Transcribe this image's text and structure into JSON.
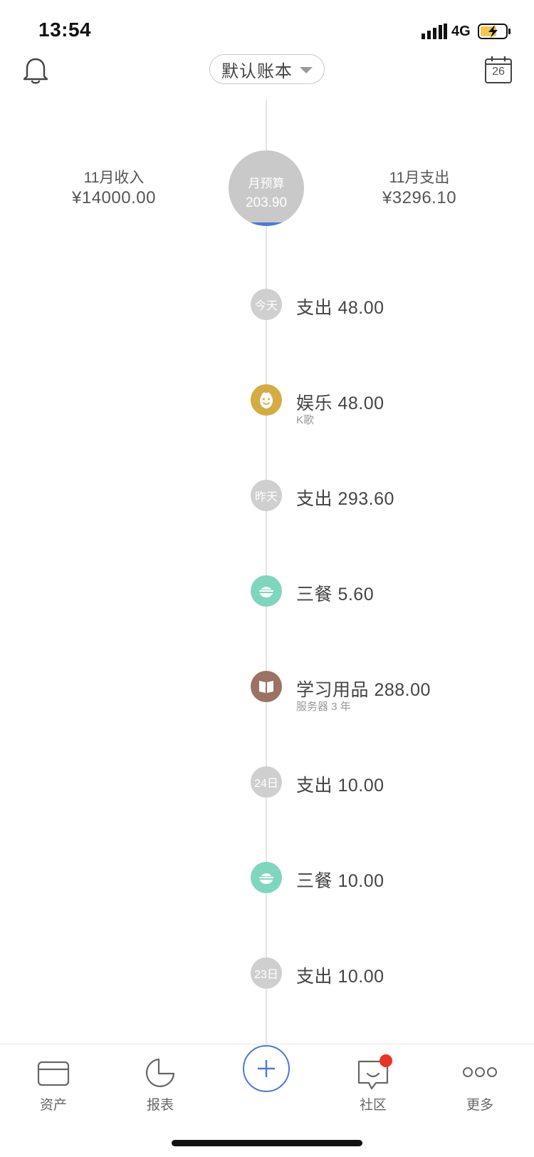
{
  "status_bar": {
    "time": "13:54",
    "network": "4G"
  },
  "header": {
    "ledger_name": "默认账本",
    "calendar_day": "26"
  },
  "summary": {
    "income_label": "11月收入",
    "income_value": "¥14000.00",
    "budget_label": "月预算",
    "budget_value": "203.90",
    "expense_label": "11月支出",
    "expense_value": "¥3296.10"
  },
  "entries": [
    {
      "node_text": "今天",
      "text": "支出 48.00",
      "note": ""
    },
    {
      "icon": "entertainment-icon",
      "text": "娱乐 48.00",
      "note": "K歌",
      "color": "#d4ac43"
    },
    {
      "node_text": "昨天",
      "text": "支出 293.60",
      "note": ""
    },
    {
      "icon": "meal-bowl-icon",
      "text": "三餐 5.60",
      "note": "",
      "color": "#7fd6bf"
    },
    {
      "icon": "book-icon",
      "text": "学习用品 288.00",
      "note": "服务器 3 年",
      "color": "#9b7264"
    },
    {
      "node_text": "24日",
      "text": "支出 10.00",
      "note": ""
    },
    {
      "icon": "meal-bowl-icon",
      "text": "三餐 10.00",
      "note": "",
      "color": "#7fd6bf"
    },
    {
      "node_text": "23日",
      "text": "支出 10.00",
      "note": ""
    }
  ],
  "tabbar": {
    "assets": "资产",
    "reports": "报表",
    "community": "社区",
    "more": "更多"
  },
  "colors": {
    "accent": "#4e79d6",
    "badge": "#ec3226",
    "day_node": "#cfcfcf"
  }
}
